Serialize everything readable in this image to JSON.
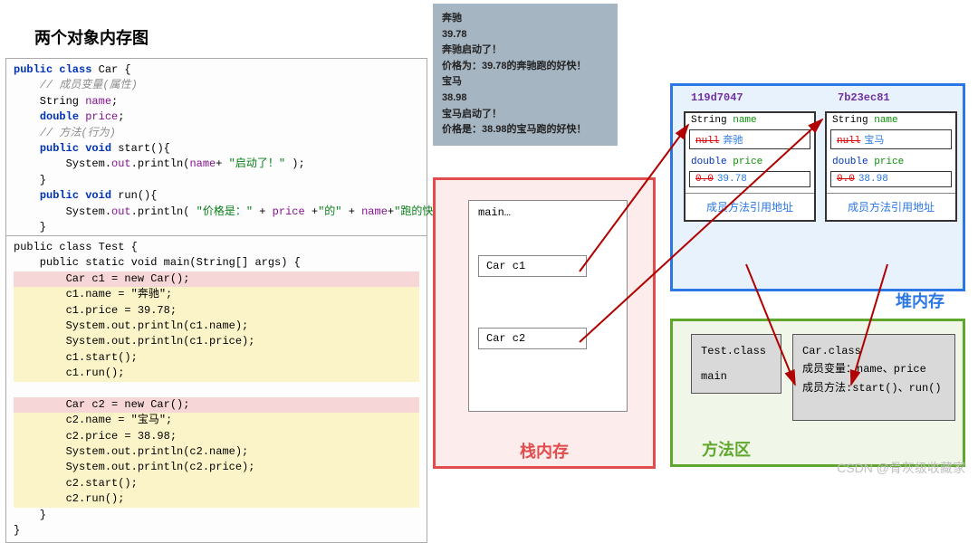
{
  "title": "两个对象内存图",
  "code_car": "public class Car {\n    // 成员变量(属性)\n    String name;\n    double price;\n    // 方法(行为)\n    public void start(){\n        System.out.println(name+ \"启动了！\" );\n    }\n    public void run(){\n        System.out.println( \"价格是：\" + price +\"的\" + name+\"跑的快！\");\n    }\n}",
  "code_test": {
    "l0": "public class Test {",
    "l1": "    public static void main(String[] args) {",
    "l2": "        Car c1 = new Car();",
    "l3": "        c1.name = \"奔驰\";",
    "l4": "        c1.price = 39.78;",
    "l5": "        System.out.println(c1.name);",
    "l6": "        System.out.println(c1.price);",
    "l7": "        c1.start();",
    "l8": "        c1.run();",
    "l9": "",
    "l10": "        Car c2 = new Car();",
    "l11": "        c2.name = \"宝马\";",
    "l12": "        c2.price = 38.98;",
    "l13": "        System.out.println(c2.name);",
    "l14": "        System.out.println(c2.price);",
    "l15": "        c2.start();",
    "l16": "        c2.run();",
    "l17": "    }",
    "l18": "}"
  },
  "console_lines": [
    "奔驰",
    "39.78",
    "奔驰启动了！",
    "价格为：39.78的奔驰跑的好快！",
    "宝马",
    "38.98",
    "宝马启动了！",
    "价格是：38.98的宝马跑的好快！"
  ],
  "stack": {
    "label": "栈内存",
    "frame": "main…",
    "var1": "Car   c1",
    "var2": "Car   c2"
  },
  "heap": {
    "label": "堆内存",
    "obj1": {
      "addr": "119d7047",
      "f1": "String name",
      "v1_old": "null",
      "v1": "奔驰",
      "f2": "double price",
      "v2_old": "0.0",
      "v2": "39.78",
      "mref": "成员方法引用地址"
    },
    "obj2": {
      "addr": "7b23ec81",
      "f1": "String name",
      "v1_old": "null",
      "v1": "宝马",
      "f2": "double price",
      "v2_old": "0.0",
      "v2": "38.98",
      "mref": "成员方法引用地址"
    }
  },
  "method_area": {
    "label": "方法区",
    "test": {
      "name": "Test.class",
      "m": "main"
    },
    "car": {
      "name": "Car.class",
      "fields": "成员变量：name、price",
      "methods": "成员方法:start()、run()"
    }
  },
  "watermark": "CSDN @骨灰级收藏家"
}
